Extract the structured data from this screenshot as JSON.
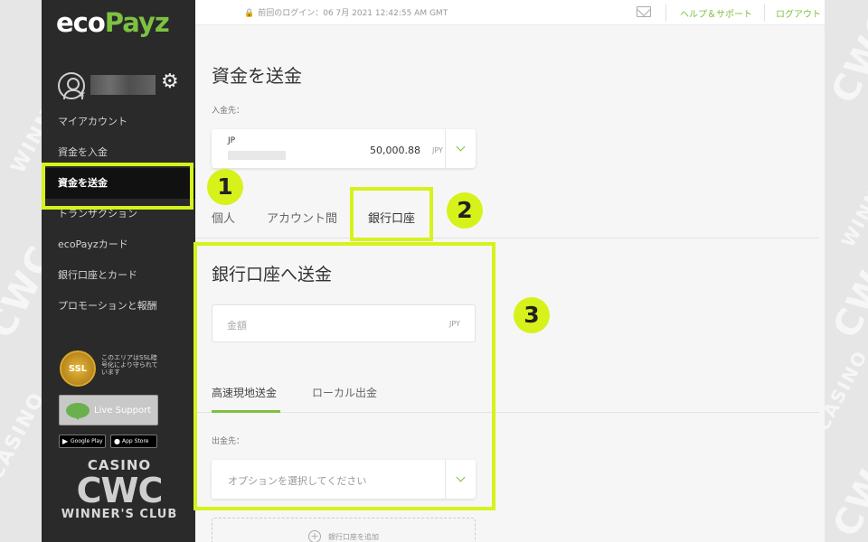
{
  "watermark": {
    "line1": "CASINO",
    "line2": "CWC",
    "line3": "WINNER'S CLUB"
  },
  "sidebar": {
    "logo_main": "eco",
    "logo_accent": "Payz",
    "menu": [
      {
        "label": "マイアカウント"
      },
      {
        "label": "資金を入金"
      },
      {
        "label": "資金を送金"
      },
      {
        "label": "トランザクション"
      },
      {
        "label": "ecoPayzカード"
      },
      {
        "label": "銀行口座とカード"
      },
      {
        "label": "プロモーションと報酬"
      }
    ],
    "ssl_badge": "SSL",
    "ssl_text": "このエリアはSSL暗号化により守られています",
    "live_support": "Live Support",
    "google_play": "Google Play",
    "app_store": "App Store",
    "brand": {
      "line1": "CASINO",
      "line2": "CWC",
      "line3": "WINNER'S CLUB"
    }
  },
  "topbar": {
    "last_login": "前回のログイン：06 7月 2021 12:42:55 AM GMT",
    "help": "ヘルプ＆サポート",
    "logout": "ログアウト"
  },
  "main": {
    "title": "資金を送金",
    "from_label": "入金先：",
    "account": {
      "currency": "JP",
      "amount": "50,000.88",
      "unit": "JPY"
    },
    "tabs": [
      {
        "label": "個人"
      },
      {
        "label": "アカウント間"
      },
      {
        "label": "銀行口座"
      }
    ],
    "section_title": "銀行口座へ送金",
    "amount_placeholder": "金額",
    "amount_unit": "JPY",
    "subtabs": [
      {
        "label": "高速現地送金"
      },
      {
        "label": "ローカル出金"
      }
    ],
    "dest_label": "出金先：",
    "option_placeholder": "オプションを選択してください",
    "add_bank": "銀行口座を追加"
  },
  "annotations": {
    "badge1": "1",
    "badge2": "2",
    "badge3": "3",
    "highlight_color": "#d6f21a"
  },
  "colors": {
    "accent": "#7dc142",
    "sidebar_bg": "#2a2a2a",
    "highlight": "#d6f21a"
  }
}
